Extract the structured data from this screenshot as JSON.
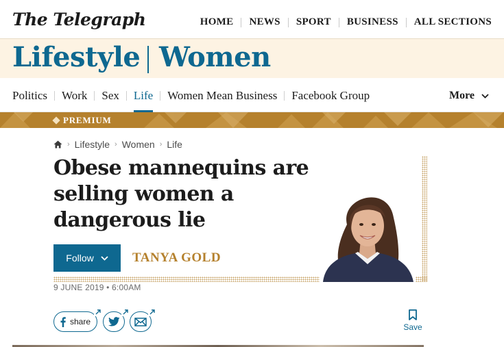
{
  "brand": {
    "logo": "The Telegraph"
  },
  "topnav": [
    "HOME",
    "NEWS",
    "SPORT",
    "BUSINESS",
    "ALL SECTIONS"
  ],
  "section": {
    "primary": "Lifestyle",
    "secondary": "Women"
  },
  "subnav": {
    "items": [
      "Politics",
      "Work",
      "Sex",
      "Life",
      "Women Mean Business",
      "Facebook Group"
    ],
    "active": "Life",
    "more_label": "More"
  },
  "premium": {
    "label": "PREMIUM"
  },
  "breadcrumb": [
    "Lifestyle",
    "Women",
    "Life"
  ],
  "article": {
    "headline": "Obese mannequins are selling women a dangerous lie",
    "author": "TANYA GOLD",
    "follow_label": "Follow",
    "date": "9 JUNE 2019 • 6:00AM"
  },
  "share": {
    "facebook_label": "share",
    "save_label": "Save"
  },
  "icons": [
    "home-icon",
    "chevron-down-icon",
    "facebook-icon",
    "twitter-icon",
    "email-icon",
    "external-link-icon",
    "bookmark-icon"
  ],
  "colors": {
    "accent": "#0e6890",
    "premium": "#b5812d",
    "band": "#fdf3e3"
  }
}
